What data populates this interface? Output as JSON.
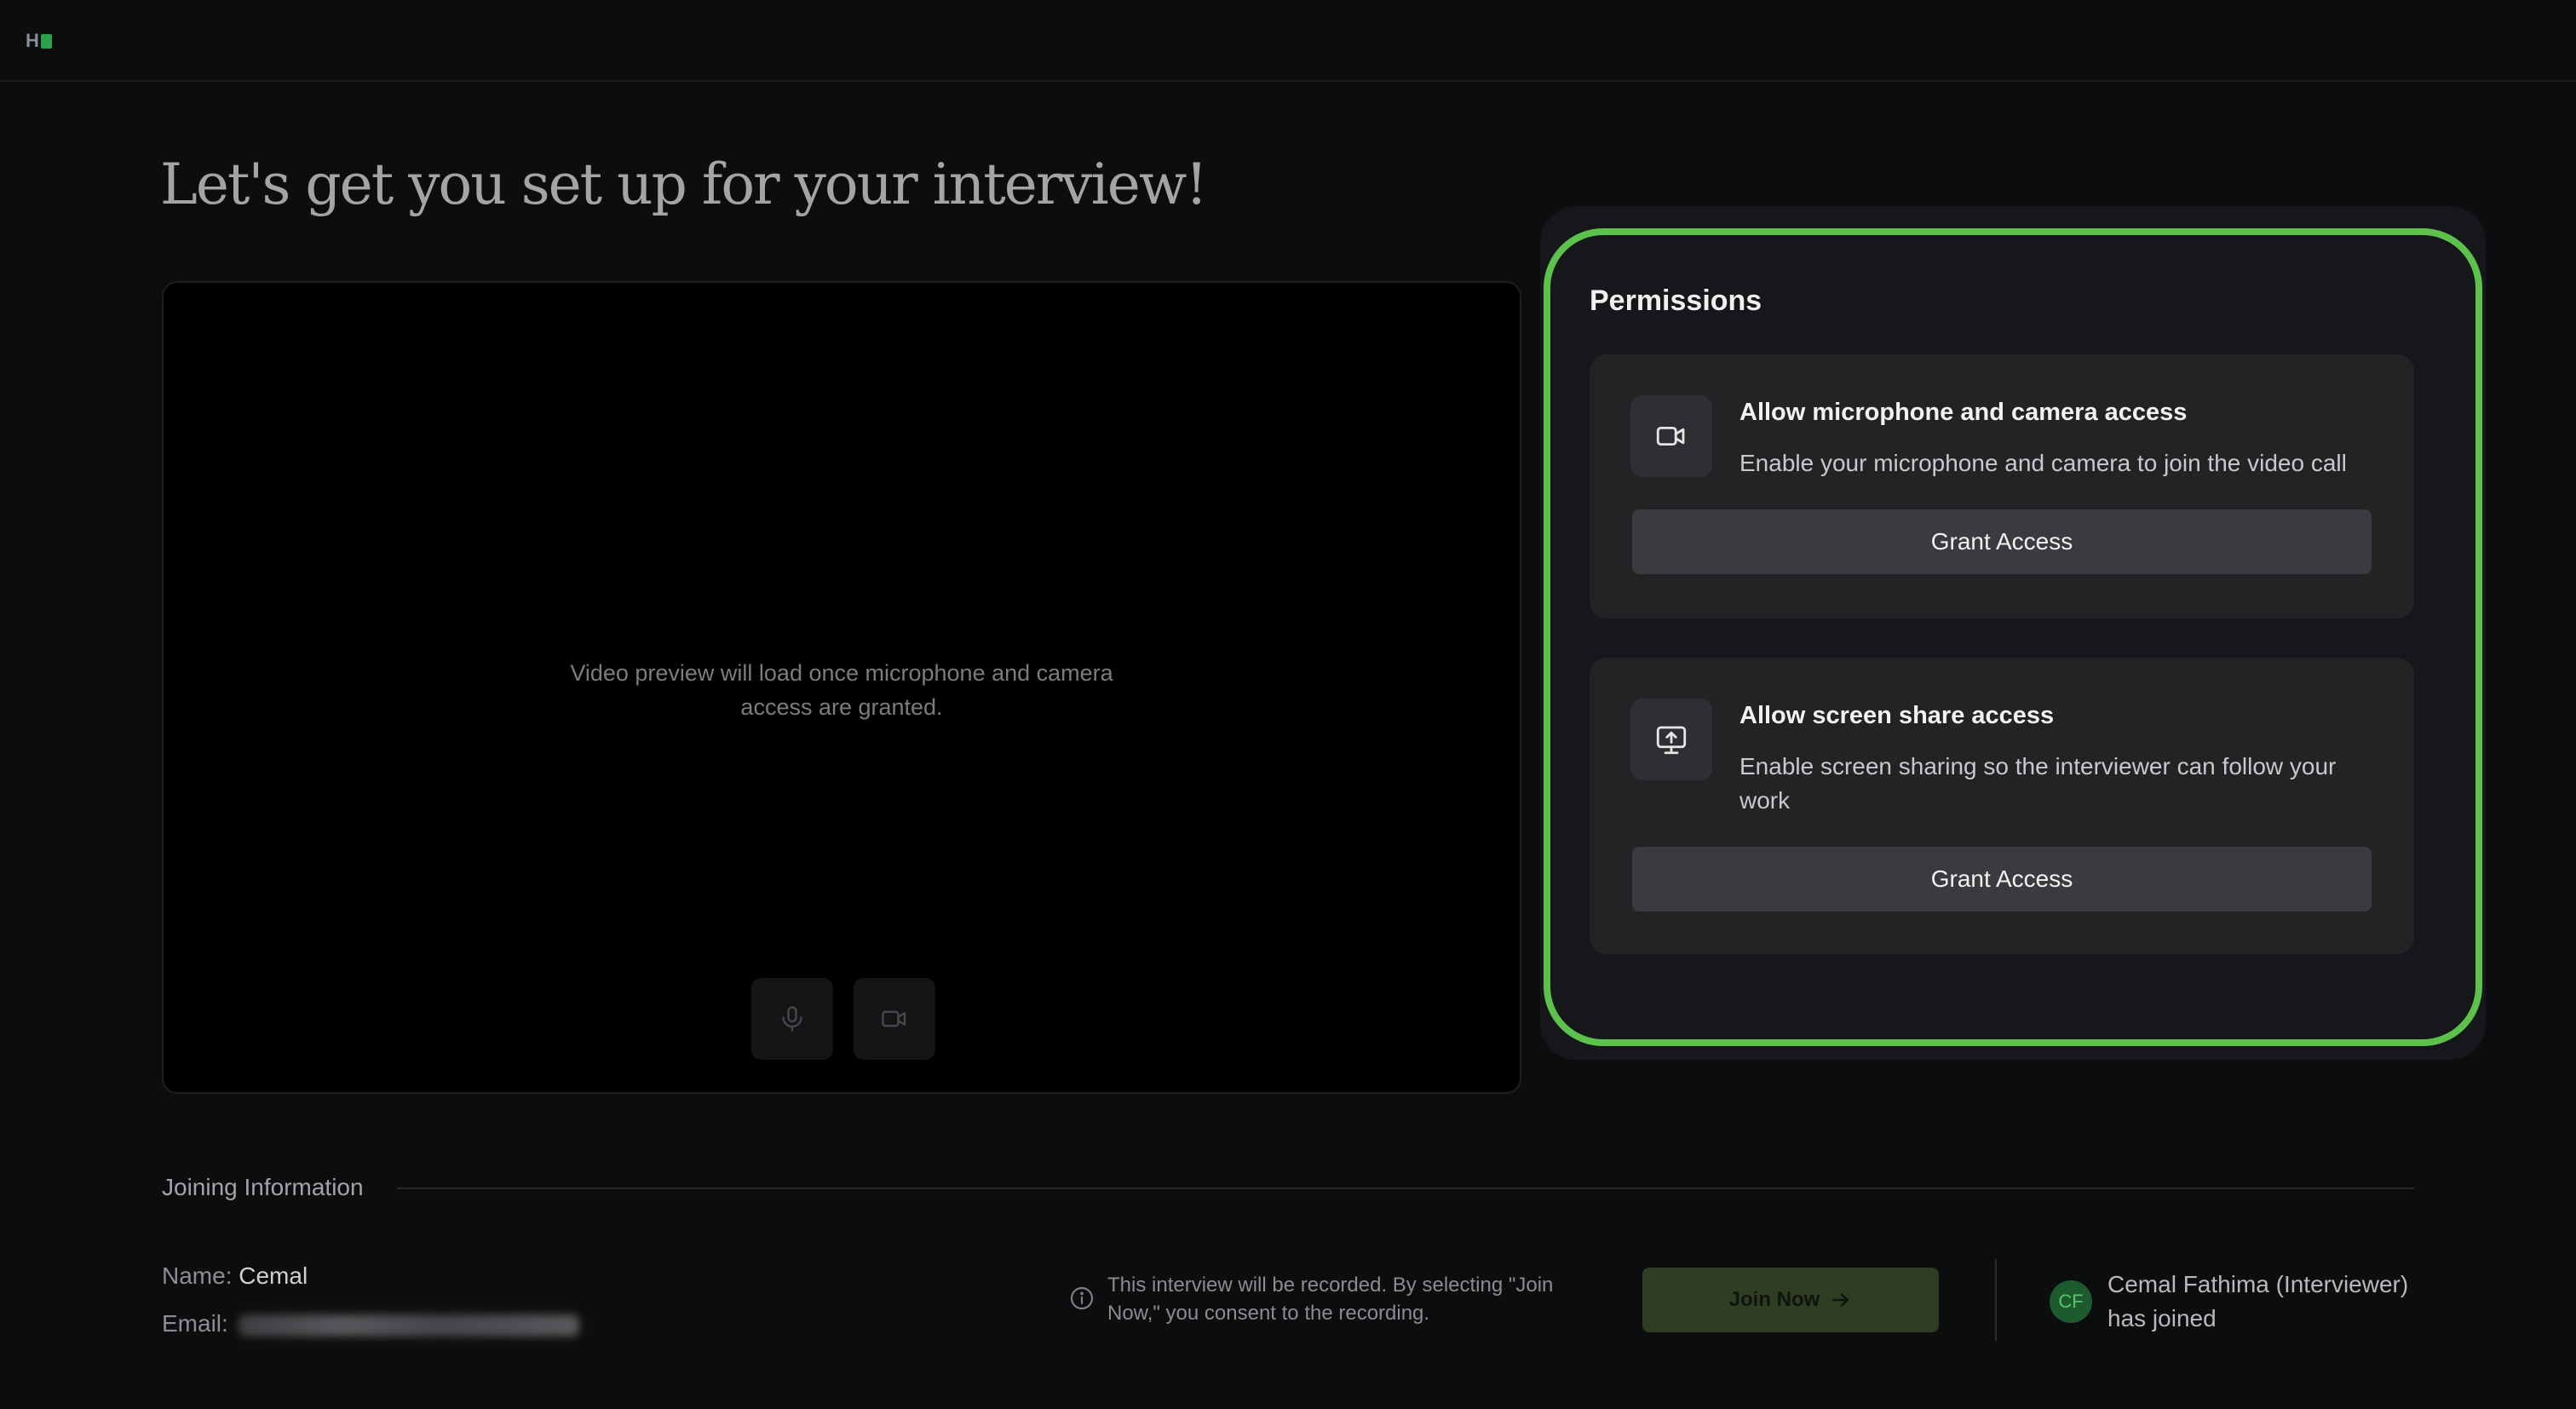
{
  "header": {
    "logo_letter": "H",
    "brand_color": "#2aa24a"
  },
  "page": {
    "title": "Let's get you set up for your interview!"
  },
  "video": {
    "message_line1": "Video preview will load once microphone and camera",
    "message_line2": "access are granted.",
    "controls": [
      {
        "icon": "microphone-icon"
      },
      {
        "icon": "camera-icon"
      }
    ]
  },
  "permissions": {
    "title": "Permissions",
    "highlight_color": "#5dc24c",
    "items": [
      {
        "icon": "camera-icon",
        "heading": "Allow microphone and camera access",
        "description": "Enable your microphone and camera to join the video call",
        "button_label": "Grant Access"
      },
      {
        "icon": "screen-share-icon",
        "heading": "Allow screen share access",
        "description": "Enable screen sharing so the interviewer can follow your work",
        "button_label": "Grant Access"
      }
    ]
  },
  "joining": {
    "label": "Joining Information",
    "name_label": "Name:",
    "name_value": "Cemal",
    "email_label": "Email:"
  },
  "recording_notice": {
    "icon": "info-icon",
    "text": "This interview will be recorded. By selecting \"Join Now,\" you consent to the recording."
  },
  "join_button": {
    "label": "Join Now",
    "icon": "arrow-right-icon",
    "color": "#2f3d23"
  },
  "interviewer": {
    "initials": "CF",
    "name": "Cemal Fathima (Interviewer)",
    "status": "has joined"
  }
}
